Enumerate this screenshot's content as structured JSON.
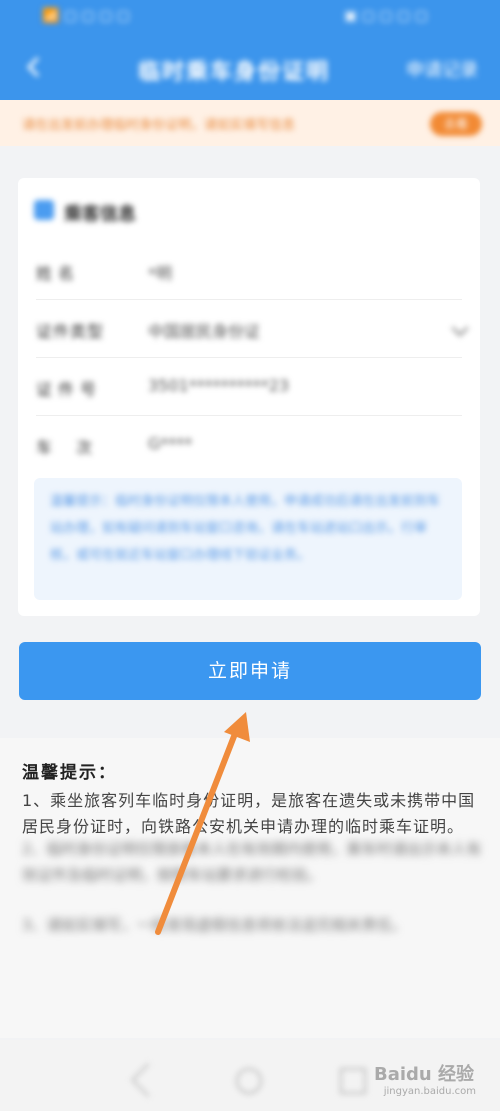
{
  "status_bar": {
    "left": "📶 ▢ ▢ ▢ ▢",
    "right": "▣ ▢ ▢ ▢ ▢"
  },
  "header": {
    "title": "临时乘车身份证明",
    "link": "申请记录"
  },
  "notice": {
    "text": "请在出发前办理临时身份证明，请如实填写信息",
    "button": "去看"
  },
  "section": {
    "title": "乘客信息"
  },
  "form": {
    "rows": [
      {
        "label": "姓名",
        "value": "*明"
      },
      {
        "label": "证件类型",
        "value": "中国居民身份证"
      },
      {
        "label": "证件号",
        "value": "3501**********23"
      },
      {
        "label": "车次",
        "value": "G****"
      }
    ],
    "info": "温馨提示：临时身份证明仅限本人使用，申请成功后请在出发前到车站办理，如有疑问请到车站窗口咨询，请在车站进站口出示。行审核，或可在就近车站窗口办理线下验证业务。"
  },
  "apply_button": "立即申请",
  "tips": {
    "title": "温馨提示：",
    "item1": "1、乘坐旅客列车临时身份证明，是旅客在遗失或未携带中国居民身份证时，向铁路公安机关申请办理的临时乘车证明。",
    "item2": "2、临时身份证明仅限旅客本人在有效期内使用，乘车时请出示本人有效证件及临时证明，按照车站要求进行检验。",
    "item3": "3、请如实填写，一经发现虚假信息将依法追究相关责任。"
  },
  "watermark": {
    "brand": "Bai⁠du 经验",
    "url": "jingyan.baidu.com"
  },
  "colors": {
    "primary": "#3c95ec",
    "accent_orange": "#f28a34",
    "annotation_arrow": "#f08c3c"
  }
}
